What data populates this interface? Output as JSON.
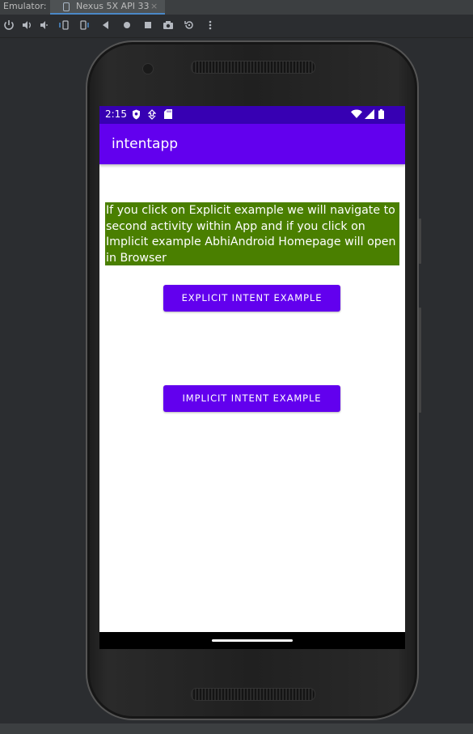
{
  "ide": {
    "emulator_label": "Emulator:",
    "device_tab": "Nexus 5X API 33",
    "close_glyph": "×",
    "toolbar_icons": [
      "power-icon",
      "volume-up-icon",
      "volume-down-icon",
      "rotate-left-icon",
      "rotate-right-icon",
      "back-icon",
      "home-icon",
      "overview-icon",
      "screenshot-icon",
      "replay-icon",
      "more-icon"
    ]
  },
  "phone": {
    "status_bar": {
      "time": "2:15",
      "icons": [
        "shield-icon",
        "data-saver-icon",
        "sd-card-icon",
        "wifi-icon",
        "signal-icon",
        "battery-icon"
      ]
    },
    "app_bar": {
      "title": "intentapp"
    },
    "content": {
      "info_text": "If you click on Explicit example we will navigate to second activity within App and if you click on Implicit example AbhiAndroid Homepage will open in Browser",
      "explicit_button": "EXPLICIT INTENT EXAMPLE",
      "implicit_button": "IMPLICIT INTENT EXAMPLE"
    }
  },
  "colors": {
    "status_bar": "#3700b3",
    "app_bar": "#6200ee",
    "button": "#6200ee",
    "info_background": "#4a7f00"
  }
}
